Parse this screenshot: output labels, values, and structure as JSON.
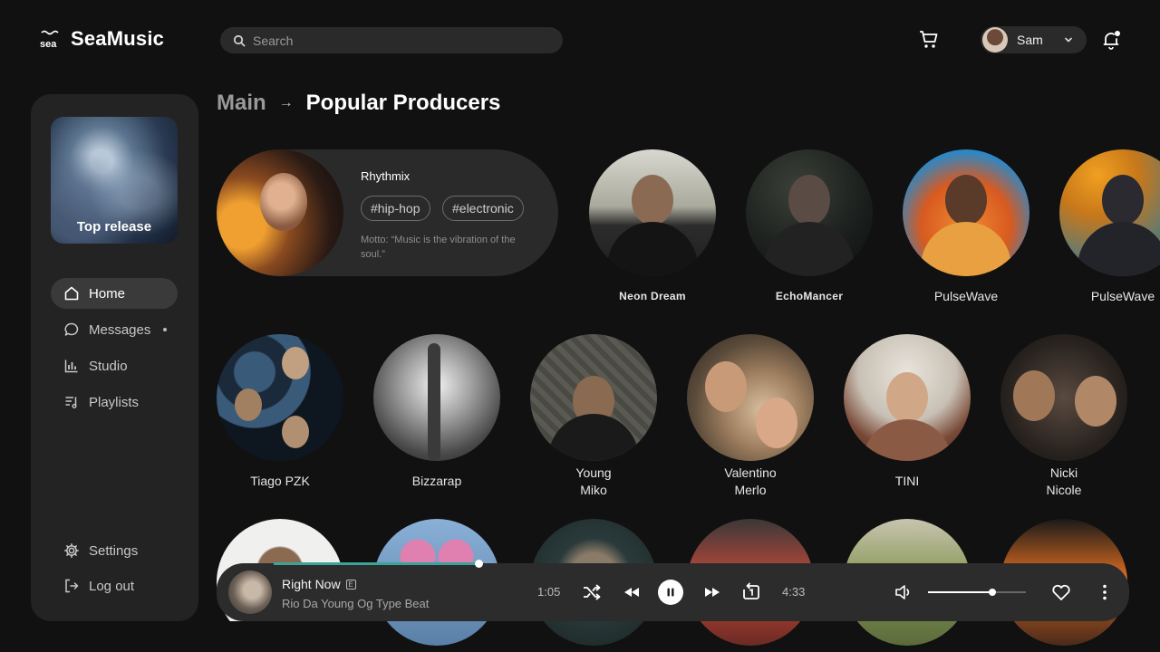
{
  "app": {
    "name": "SeaMusic",
    "logo_text": "sea"
  },
  "search": {
    "placeholder": "Search"
  },
  "user": {
    "name": "Sam"
  },
  "sidebar": {
    "top_release_label": "Top release",
    "items": [
      {
        "label": "Home",
        "active": true,
        "icon": "home-icon"
      },
      {
        "label": "Messages",
        "active": false,
        "icon": "chat-bubble-icon",
        "has_dot": true
      },
      {
        "label": "Studio",
        "active": false,
        "icon": "bar-chart-icon"
      },
      {
        "label": "Playlists",
        "active": false,
        "icon": "playlist-icon"
      }
    ],
    "bottom_items": [
      {
        "label": "Settings",
        "icon": "gear-icon"
      },
      {
        "label": "Log out",
        "icon": "logout-icon"
      }
    ]
  },
  "breadcrumb": {
    "parent": "Main",
    "current": "Popular Producers"
  },
  "featured": {
    "name": "Rhythmix",
    "tags": [
      "#hip-hop",
      "#electronic"
    ],
    "motto": "Motto: “Music is the vibration of the soul.”"
  },
  "producers": [
    {
      "name": "Neon Dream"
    },
    {
      "name": "EchoMancer"
    },
    {
      "name": "PulseWave"
    },
    {
      "name": "PulseWave"
    },
    {
      "name": "Tiago PZK"
    },
    {
      "name": "Bizzarap"
    },
    {
      "name": "Young\nMiko"
    },
    {
      "name": "Valentino\nMerlo"
    },
    {
      "name": "TINI"
    },
    {
      "name": "Nicki\nNicole"
    }
  ],
  "player": {
    "title": "Right Now",
    "explicit_mark": "E",
    "subtitle": "Rio Da Young Og Type Beat",
    "elapsed": "1:05",
    "duration": "4:33",
    "progress": 0.24,
    "volume": 0.66
  },
  "colors": {
    "accent": "#3aa39a",
    "background": "#111111",
    "panel": "#232323"
  }
}
